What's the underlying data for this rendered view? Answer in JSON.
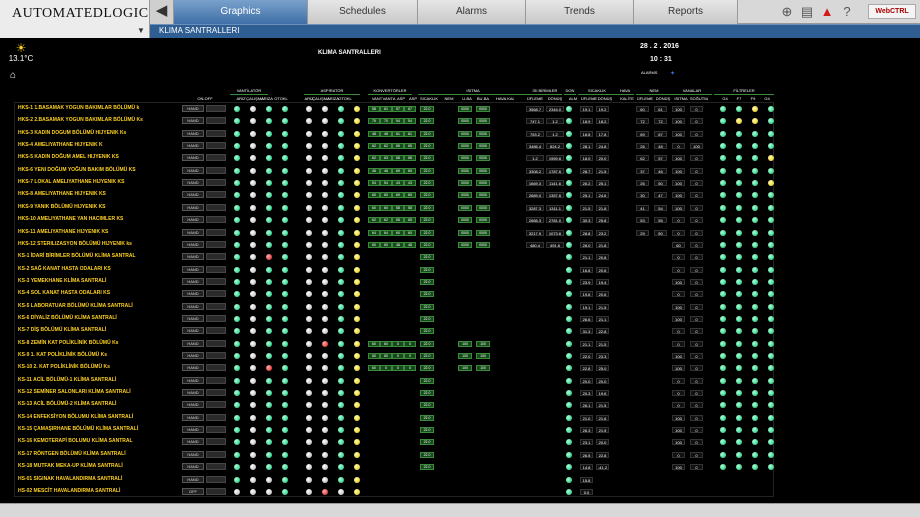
{
  "app": {
    "logo_text": "AUTOMATEDLOGIC",
    "logo_reg": "®"
  },
  "tabs": [
    {
      "label": "Graphics",
      "active": true
    },
    {
      "label": "Schedules",
      "active": false
    },
    {
      "label": "Alarms",
      "active": false
    },
    {
      "label": "Trends",
      "active": false
    },
    {
      "label": "Reports",
      "active": false
    }
  ],
  "toolbar": {
    "webctrl": "WebCTRL",
    "icons": [
      "binoculars-icon",
      "print-icon",
      "alarm-triangle-icon",
      "help-icon"
    ]
  },
  "nav": {
    "breadcrumb": "KLIMA SANTRALLERI"
  },
  "header": {
    "title": "KLIMA SANTRALLERI",
    "date": "28 . 2 . 2016",
    "time": "10 : 31",
    "temp": "13.1°C",
    "alarm_label": "ALARMS"
  },
  "columns": {
    "groups": [
      {
        "label": "VANTİLATÖR"
      },
      {
        "label": "ASPİRATÖR"
      },
      {
        "label": "KONVERTÖRLER"
      },
      {
        "label": "ISITMA"
      },
      {
        "label": "İSI BİRİMLER"
      },
      {
        "label": "DON"
      },
      {
        "label": "SICAKLIK"
      },
      {
        "label": "HAVA"
      },
      {
        "label": "NEM"
      },
      {
        "label": "VANALAR"
      },
      {
        "label": "FİLTRELER"
      }
    ],
    "subs": [
      "ON-OFF",
      "ARIZ",
      "ÇALIŞMA",
      "ARIZA",
      "OTOKL",
      "ARIZ",
      "ÇALIŞMA",
      "ARIZA",
      "OTOKL",
      "VANT",
      "VANTA",
      "ASP",
      "ASP",
      "SICAKLIK",
      "NEM",
      "U-BA",
      "BU-BA",
      "HAVA KALİTE",
      "ÜFLEME",
      "DÖNÜŞ",
      "ALM",
      "ÜFLEME",
      "DÖNÜŞ",
      "KALİTE",
      "ÜFLEME",
      "DÖNÜŞ",
      "ISITMA",
      "SOĞUTMA",
      "G4",
      "F7",
      "F9",
      "G4"
    ]
  },
  "rows": [
    {
      "name": "HKS-1 1.BASAMAK YOGUN BAKIMLAR BÖLÜMÜ k",
      "mode": "HAND",
      "v": [
        "58",
        "61",
        "57",
        "67"
      ],
      "k": "22.0",
      "i": [
        "0000",
        "0000"
      ],
      "u": [
        "3568.7",
        "2344.0"
      ],
      "s": [
        "19.1",
        "19.2"
      ],
      "n": [
        "60",
        "61"
      ],
      "va": [
        "100",
        "0"
      ],
      "dots": "gwggwwgyg",
      "f": "ggyg"
    },
    {
      "name": "HKS-2 2.BASAMAK YOGUN BAKIMLAR BÖLÜMÜ Ks",
      "mode": "HAND",
      "v": [
        "75",
        "70",
        "54",
        "54"
      ],
      "k": "22.0",
      "i": [
        "0000",
        "0000"
      ],
      "u": [
        "747.1",
        "1.2"
      ],
      "s": [
        "18.9",
        "18.2"
      ],
      "n": [
        "72",
        "72"
      ],
      "va": [
        "100",
        "0"
      ],
      "dots": "gwggwwgyg",
      "f": "gyyg"
    },
    {
      "name": "HKS-3 KADIN DOGUM BÖLÜMÜ HIJYENIK Ks",
      "mode": "HAND",
      "v": [
        "48",
        "48",
        "61",
        "61"
      ],
      "k": "22.0",
      "i": [
        "0000",
        "0000"
      ],
      "u": [
        "753.2",
        "1.2"
      ],
      "s": [
        "18.8",
        "17.8"
      ],
      "n": [
        "69",
        "67"
      ],
      "va": [
        "100",
        "0"
      ],
      "dots": "gwggwwgyg",
      "f": "gggg"
    },
    {
      "name": "HKS-4 AMELIYATHANE HIJYENIK K",
      "mode": "HAND",
      "v": [
        "62",
        "62",
        "65",
        "65"
      ],
      "k": "22.0",
      "i": [
        "0000",
        "0000"
      ],
      "u": [
        "3486.4",
        "824.2"
      ],
      "s": [
        "28.1",
        "24.8"
      ],
      "n": [
        "26",
        "48"
      ],
      "va": [
        "0",
        "100"
      ],
      "dots": "gwggwwgyg",
      "f": "gggg"
    },
    {
      "name": "HKS-5 KADIN DOĞUM AMEL HIJYENIK KS",
      "mode": "HAND",
      "v": [
        "62",
        "63",
        "68",
        "68"
      ],
      "k": "22.0",
      "i": [
        "0000",
        "0000"
      ],
      "u": [
        "1.2",
        "1959.6"
      ],
      "s": [
        "18.0",
        "20.0"
      ],
      "n": [
        "62",
        "57"
      ],
      "va": [
        "100",
        "0"
      ],
      "dots": "gwggwwgyg",
      "f": "gggy"
    },
    {
      "name": "HKS-6 YENI DOĞUM YOĞUN BAKIM BÖLÜMÜ KS",
      "mode": "HAND",
      "v": [
        "46",
        "46",
        "69",
        "69"
      ],
      "k": "22.0",
      "i": [
        "0000",
        "0000"
      ],
      "u": [
        "3308.2",
        "1787.6"
      ],
      "s": [
        "28.7",
        "21.5"
      ],
      "n": [
        "37",
        "46"
      ],
      "va": [
        "100",
        "0"
      ],
      "dots": "gwggwwgyg",
      "f": "gggg"
    },
    {
      "name": "HKS-7 LOKAL AMELIYATHANE HIJYENIK KS",
      "mode": "HAND",
      "v": [
        "54",
        "54",
        "43",
        "43"
      ],
      "k": "22.0",
      "i": [
        "0000",
        "0000"
      ],
      "u": [
        "1669.3",
        "1141.6"
      ],
      "s": [
        "26.2",
        "25.1"
      ],
      "n": [
        "26",
        "50"
      ],
      "va": [
        "100",
        "0"
      ],
      "dots": "gwggwwgyg",
      "f": "gggy"
    },
    {
      "name": "HKS-8 AMELIYATHANE HIJYENIK KS",
      "mode": "HAND",
      "v": [
        "60",
        "60",
        "69",
        "69"
      ],
      "k": "22.0",
      "i": [
        "0000",
        "0000"
      ],
      "u": [
        "2689.0",
        "1357.6"
      ],
      "s": [
        "25.1",
        "24.6"
      ],
      "n": [
        "30",
        "47"
      ],
      "va": [
        "100",
        "0"
      ],
      "dots": "gwggwwgyg",
      "f": "gggg"
    },
    {
      "name": "HKS-9 YANIK BÖLÜMÜ HIJYENIK KS",
      "mode": "HAND",
      "v": [
        "60",
        "60",
        "58",
        "58"
      ],
      "k": "22.0",
      "i": [
        "0000",
        "0000"
      ],
      "u": [
        "3287.3",
        "1311.1"
      ],
      "s": [
        "21.5",
        "21.8"
      ],
      "n": [
        "41",
        "54"
      ],
      "va": [
        "100",
        "0"
      ],
      "dots": "gwggwwgyg",
      "f": "gggg"
    },
    {
      "name": "HKS-10 AMELIYATHANE YAN HACIMLER KS",
      "mode": "HAND",
      "v": [
        "62",
        "62",
        "65",
        "65"
      ],
      "k": "22.0",
      "i": [
        "0000",
        "0000"
      ],
      "u": [
        "2666.3",
        "2781.0"
      ],
      "s": [
        "30.3",
        "25.8"
      ],
      "n": [
        "53",
        "55"
      ],
      "va": [
        "0",
        "0"
      ],
      "dots": "gwggwwgyg",
      "f": "gggg"
    },
    {
      "name": "HKS-11 AMELIYATHANE HIJYENIK KS",
      "mode": "HAND",
      "v": [
        "64",
        "64",
        "60",
        "60"
      ],
      "k": "22.0",
      "i": [
        "0000",
        "0000"
      ],
      "u": [
        "3217.9",
        "1073.6"
      ],
      "s": [
        "28.8",
        "23.2"
      ],
      "n": [
        "29",
        "50"
      ],
      "va": [
        "0",
        "0"
      ],
      "dots": "gwggwwgyg",
      "f": "gggg"
    },
    {
      "name": "HKS-12 STERILIZASYON BÖLÜMÜ HIJYENIK ks",
      "mode": "HAND",
      "v": [
        "60",
        "60",
        "48",
        "48"
      ],
      "k": "22.0",
      "i": [
        "0000",
        "0000"
      ],
      "u": [
        "480.4",
        "491.6"
      ],
      "s": [
        "28.0",
        "21.8"
      ],
      "n": [
        "",
        ""
      ],
      "va": [
        "60",
        "0"
      ],
      "dots": "gwggwwgyg",
      "f": "gggg"
    },
    {
      "name": "KS-1 İDARİ BİRİMLER BÖLÜMÜ KLİMA SANTRAL",
      "mode": "HAND",
      "v": [
        "",
        "",
        "",
        ""
      ],
      "k": "22.0",
      "i": [
        "",
        ""
      ],
      "u": [
        "",
        ""
      ],
      "s": [
        "21.1",
        "20.8"
      ],
      "n": [
        "",
        ""
      ],
      "va": [
        "0",
        "0"
      ],
      "dots": "gwrgwwgyg",
      "f": "gggg"
    },
    {
      "name": "KS-2 SAĞ KANAT HASTA ODALARI KS",
      "mode": "HAND",
      "v": [
        "",
        "",
        "",
        ""
      ],
      "k": "22.0",
      "i": [
        "",
        ""
      ],
      "u": [
        "",
        ""
      ],
      "s": [
        "16.6",
        "20.6"
      ],
      "n": [
        "",
        ""
      ],
      "va": [
        "0",
        "0"
      ],
      "dots": "gwggwwgyg",
      "f": "gggg"
    },
    {
      "name": "KS-3 YEMEKHANE KLİMA SANTRALİ",
      "mode": "HAND",
      "v": [
        "",
        "",
        "",
        ""
      ],
      "k": "22.0",
      "i": [
        "",
        ""
      ],
      "u": [
        "",
        ""
      ],
      "s": [
        "23.9",
        "19.4"
      ],
      "n": [
        "",
        ""
      ],
      "va": [
        "100",
        "0"
      ],
      "dots": "gwggwwgyg",
      "f": "gggg"
    },
    {
      "name": "KS-4 SOL KANAT HASTA ODALARI KS",
      "mode": "HAND",
      "v": [
        "",
        "",
        "",
        ""
      ],
      "k": "22.0",
      "i": [
        "",
        ""
      ],
      "u": [
        "",
        ""
      ],
      "s": [
        "19.6",
        "20.6"
      ],
      "n": [
        "",
        ""
      ],
      "va": [
        "0",
        "0"
      ],
      "dots": "gwggwwgyg",
      "f": "gggg"
    },
    {
      "name": "KS-5 LABORATUAR BÖLÜMÜ KLİMA SANTRALİ",
      "mode": "HAND",
      "v": [
        "",
        "",
        "",
        ""
      ],
      "k": "22.0",
      "i": [
        "",
        ""
      ],
      "u": [
        "",
        ""
      ],
      "s": [
        "19.1",
        "21.5"
      ],
      "n": [
        "",
        ""
      ],
      "va": [
        "100",
        "0"
      ],
      "dots": "gwggwwgyg",
      "f": "gggg"
    },
    {
      "name": "KS-6 DİYALİZ BÖLÜMÜ KLİMA SANTRALİ",
      "mode": "HAND",
      "v": [
        "",
        "",
        "",
        ""
      ],
      "k": "22.0",
      "i": [
        "",
        ""
      ],
      "u": [
        "",
        ""
      ],
      "s": [
        "26.6",
        "21.1"
      ],
      "n": [
        "",
        ""
      ],
      "va": [
        "100",
        "0"
      ],
      "dots": "gwggwwgyg",
      "f": "gggg"
    },
    {
      "name": "KS-7 DİŞ BÖLÜMÜ KLİMA SANTRALİ",
      "mode": "HAND",
      "v": [
        "",
        "",
        "",
        ""
      ],
      "k": "22.0",
      "i": [
        "",
        ""
      ],
      "u": [
        "",
        ""
      ],
      "s": [
        "31.3",
        "22.8"
      ],
      "n": [
        "",
        ""
      ],
      "va": [
        "0",
        "0"
      ],
      "dots": "gwggwwgyg",
      "f": "gggg"
    },
    {
      "name": "KS-8 ZEMİN KAT POLİKLİNİK BÖLÜMÜ Ks",
      "mode": "HAND",
      "v": [
        "60",
        "60",
        "0",
        "0"
      ],
      "k": "22.0",
      "i": [
        "100",
        "100"
      ],
      "u": [
        "",
        ""
      ],
      "s": [
        "21.1",
        "21.5"
      ],
      "n": [
        "",
        ""
      ],
      "va": [
        "0",
        "0"
      ],
      "dots": "gwggwrgyg",
      "f": "gggg"
    },
    {
      "name": "KS-9 1. KAT POLİKLİNİK BÖLÜMÜ Ks",
      "mode": "HAND",
      "v": [
        "60",
        "60",
        "0",
        "0"
      ],
      "k": "22.0",
      "i": [
        "100",
        "100"
      ],
      "u": [
        "",
        ""
      ],
      "s": [
        "22.0",
        "23.3"
      ],
      "n": [
        "",
        ""
      ],
      "va": [
        "100",
        "0"
      ],
      "dots": "gwggwwgyg",
      "f": "gggg"
    },
    {
      "name": "KS-10 2. KAT POLİKLİNİK BÖLÜMÜ Ks",
      "mode": "HAND",
      "v": [
        "60",
        "0",
        "0",
        "0"
      ],
      "k": "22.0",
      "i": [
        "100",
        "100"
      ],
      "u": [
        "",
        ""
      ],
      "s": [
        "22.8",
        "25.0"
      ],
      "n": [
        "",
        ""
      ],
      "va": [
        "100",
        "0"
      ],
      "dots": "gwrgwwgyg",
      "f": "gggg"
    },
    {
      "name": "KS-11 ACİL BÖLÜMÜ-1 KLİMA SANTRALİ",
      "mode": "HAND",
      "v": [
        "",
        "",
        "",
        ""
      ],
      "k": "22.0",
      "i": [
        "",
        ""
      ],
      "u": [
        "",
        ""
      ],
      "s": [
        "20.0",
        "20.0"
      ],
      "n": [
        "",
        ""
      ],
      "va": [
        "0",
        "0"
      ],
      "dots": "gwggwwgyg",
      "f": "gggg"
    },
    {
      "name": "KS-12 SEMİNER SALONLARI KLİMA SANTRALİ",
      "mode": "HAND",
      "v": [
        "",
        "",
        "",
        ""
      ],
      "k": "22.0",
      "i": [
        "",
        ""
      ],
      "u": [
        "",
        ""
      ],
      "s": [
        "20.3",
        "19.6"
      ],
      "n": [
        "",
        ""
      ],
      "va": [
        "0",
        "0"
      ],
      "dots": "gwggwwgyg",
      "f": "gggg"
    },
    {
      "name": "KS-13 ACİL BÖLÜMÜ-2 KLİMA SANTRALİ",
      "mode": "HAND",
      "v": [
        "",
        "",
        "",
        ""
      ],
      "k": "22.0",
      "i": [
        "",
        ""
      ],
      "u": [
        "",
        ""
      ],
      "s": [
        "26.1",
        "21.5"
      ],
      "n": [
        "",
        ""
      ],
      "va": [
        "0",
        "0"
      ],
      "dots": "gwggwwgyg",
      "f": "gggg"
    },
    {
      "name": "KS-14 ENFEKSİYON BÖLUMU KLİMA SANTRALİ",
      "mode": "HAND",
      "v": [
        "",
        "",
        "",
        ""
      ],
      "k": "22.0",
      "i": [
        "",
        ""
      ],
      "u": [
        "",
        ""
      ],
      "s": [
        "21.0",
        "21.6"
      ],
      "n": [
        "",
        ""
      ],
      "va": [
        "100",
        "0"
      ],
      "dots": "gwggwwgyg",
      "f": "gggg"
    },
    {
      "name": "KS-15 ÇAMAŞIRHANE BÖLÜMÜ KLİMA SANTRALİ",
      "mode": "HAND",
      "v": [
        "",
        "",
        "",
        ""
      ],
      "k": "22.0",
      "i": [
        "",
        ""
      ],
      "u": [
        "",
        ""
      ],
      "s": [
        "26.3",
        "21.5"
      ],
      "n": [
        "",
        ""
      ],
      "va": [
        "100",
        "0"
      ],
      "dots": "gwggwwgyg",
      "f": "gggg"
    },
    {
      "name": "KS-16 KEMOTERAPİ BOLUMU KLİMA SANTRAL",
      "mode": "HAND",
      "v": [
        "",
        "",
        "",
        ""
      ],
      "k": "22.0",
      "i": [
        "",
        ""
      ],
      "u": [
        "",
        ""
      ],
      "s": [
        "23.1",
        "20.0"
      ],
      "n": [
        "",
        ""
      ],
      "va": [
        "100",
        "0"
      ],
      "dots": "gwggwwgyg",
      "f": "gggg"
    },
    {
      "name": "KS-17 RÖNTGEN BÖLÜMÜ KLİMA SANTRALİ",
      "mode": "HAND",
      "v": [
        "",
        "",
        "",
        ""
      ],
      "k": "22.0",
      "i": [
        "",
        ""
      ],
      "u": [
        "",
        ""
      ],
      "s": [
        "26.5",
        "22.8"
      ],
      "n": [
        "",
        ""
      ],
      "va": [
        "0",
        "0"
      ],
      "dots": "gwggwwgyg",
      "f": "gggg"
    },
    {
      "name": "KS-18 MUTFAK MEKA-UP KLİMA SANTRALİ",
      "mode": "HAND",
      "v": [
        "",
        "",
        "",
        ""
      ],
      "k": "22.0",
      "i": [
        "",
        ""
      ],
      "u": [
        "",
        ""
      ],
      "s": [
        "14.8",
        "-41.2"
      ],
      "n": [
        "",
        ""
      ],
      "va": [
        "100",
        "0"
      ],
      "dots": "gwggwwgyg",
      "f": "gggg"
    },
    {
      "name": "HS-01 SIGINAK HAVALANDIRMA SANTRALİ",
      "mode": "HAND",
      "v": [
        "",
        "",
        "",
        ""
      ],
      "k": "",
      "i": [
        "",
        ""
      ],
      "u": [
        "",
        ""
      ],
      "s": [
        "15.8",
        ""
      ],
      "n": [
        "",
        ""
      ],
      "va": [
        "",
        ""
      ],
      "dots": "gwwgwwgyg",
      "f": ""
    },
    {
      "name": "HS-02 MESCİT HAVALANDIRMA SANTRALİ",
      "mode": "OFF",
      "v": [
        "",
        "",
        "",
        ""
      ],
      "k": "",
      "i": [
        "",
        ""
      ],
      "u": [
        "",
        ""
      ],
      "s": [
        "0.0",
        ""
      ],
      "n": [
        "",
        ""
      ],
      "va": [
        "",
        ""
      ],
      "dots": "wwwgwrwyg",
      "f": ""
    }
  ],
  "colors": {
    "accent": "#3e6fa6",
    "text_yellow": "#ffd21f",
    "ok_green": "#12c075",
    "alarm_red": "#d21a1a"
  }
}
